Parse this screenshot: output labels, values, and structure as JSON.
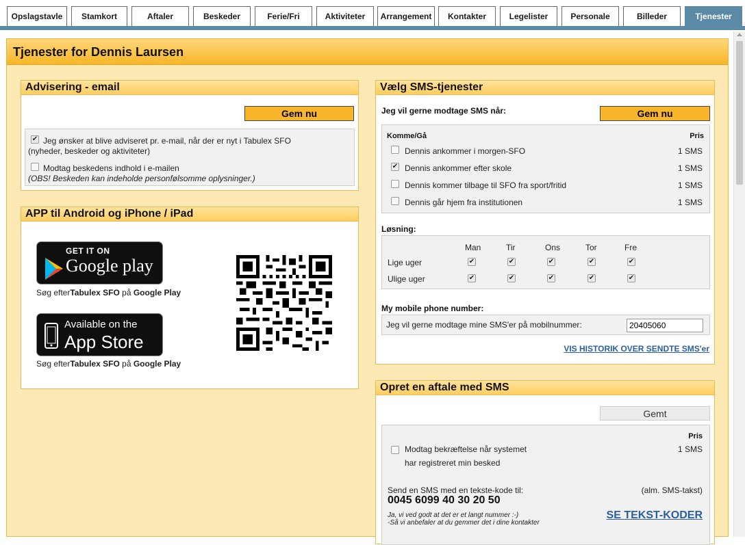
{
  "nav": {
    "tabs": [
      {
        "label": "Opslagstavle"
      },
      {
        "label": "Stamkort"
      },
      {
        "label": "Aftaler"
      },
      {
        "label": "Beskeder"
      },
      {
        "label": "Ferie/Fri"
      },
      {
        "label": "Aktiviteter"
      },
      {
        "label": "Arrangement"
      },
      {
        "label": "Kontakter"
      },
      {
        "label": "Legelister"
      },
      {
        "label": "Personale"
      },
      {
        "label": "Billeder"
      },
      {
        "label": "Tjenester"
      }
    ],
    "active": "Tjenester"
  },
  "page": {
    "title": "Tjenester for Dennis Laursen"
  },
  "email": {
    "title": "Advisering - email",
    "save_label": "Gem nu",
    "option1_line1": "Jeg ønsker at blive adviseret pr. e-mail, når der er nyt i Tabulex SFO",
    "option1_line2": "(nyheder, beskeder og aktiviteter)",
    "option1_checked": true,
    "option2_label": "Modtag beskedens indhold i e-mailen",
    "option2_checked": false,
    "option2_note": "(OBS! Beskeden kan indeholde personfølsomme oplysninger.)"
  },
  "app": {
    "title": "APP til Android og iPhone / iPad",
    "google_small": "GET IT ON",
    "google_big": "Google play",
    "apple_small": "Available on the",
    "apple_big": "App Store",
    "search_prefix": "Søg efter",
    "search_app": "Tabulex SFO",
    "search_mid": " på ",
    "search_store": "Google Play"
  },
  "sms": {
    "title": "Vælg SMS-tjenester",
    "intro": "Jeg vil gerne modtage SMS når:",
    "save_label": "Gem nu",
    "section_label": "Komme/Gå",
    "price_header": "Pris",
    "items": [
      {
        "label": "Dennis ankommer i morgen-SFO",
        "price": "1 SMS",
        "checked": false
      },
      {
        "label": "Dennis ankommer efter skole",
        "price": "1 SMS",
        "checked": true
      },
      {
        "label": "Dennis kommer tilbage til SFO fra sport/fritid",
        "price": "1 SMS",
        "checked": false
      },
      {
        "label": "Dennis går hjem fra institutionen",
        "price": "1 SMS",
        "checked": false
      }
    ],
    "losning_label": "Løsning:",
    "days": [
      "Man",
      "Tir",
      "Ons",
      "Tor",
      "Fre"
    ],
    "rows": [
      {
        "label": "Lige uger",
        "checked": [
          true,
          true,
          true,
          true,
          true
        ]
      },
      {
        "label": "Ulige uger",
        "checked": [
          true,
          true,
          true,
          true,
          true
        ]
      }
    ],
    "phone_section": "My mobile phone number:",
    "phone_label": "Jeg vil gerne modtage mine SMS'er på mobilnummer:",
    "phone_value": "20405060",
    "history_link": "VIS HISTORIK OVER SENDTE SMS'er"
  },
  "agreement": {
    "title": "Opret en aftale med SMS",
    "saved_label": "Gemt",
    "price_header": "Pris",
    "confirm_line1": "Modtag bekræftelse når systemet",
    "confirm_line2": "har registreret min besked",
    "confirm_price": "1 SMS",
    "confirm_checked": false,
    "send_label": "Send en SMS med en tekste-kode til:",
    "send_note": "(alm. SMS-takst)",
    "number": "0045 6099 40 30 20 50",
    "joke_line1": "Ja, vi ved godt at det er et langt nummer :-)",
    "joke_line2": "-Så vi anbefaler at du gemmer det i dine kontakter",
    "codes_link": "SE TEKST-KODER"
  },
  "colors": {
    "nav_active": "#5b8aa6",
    "accent_orange": "#f9b62a",
    "page_bg": "#fde9b4",
    "link": "#2a5ea0"
  }
}
